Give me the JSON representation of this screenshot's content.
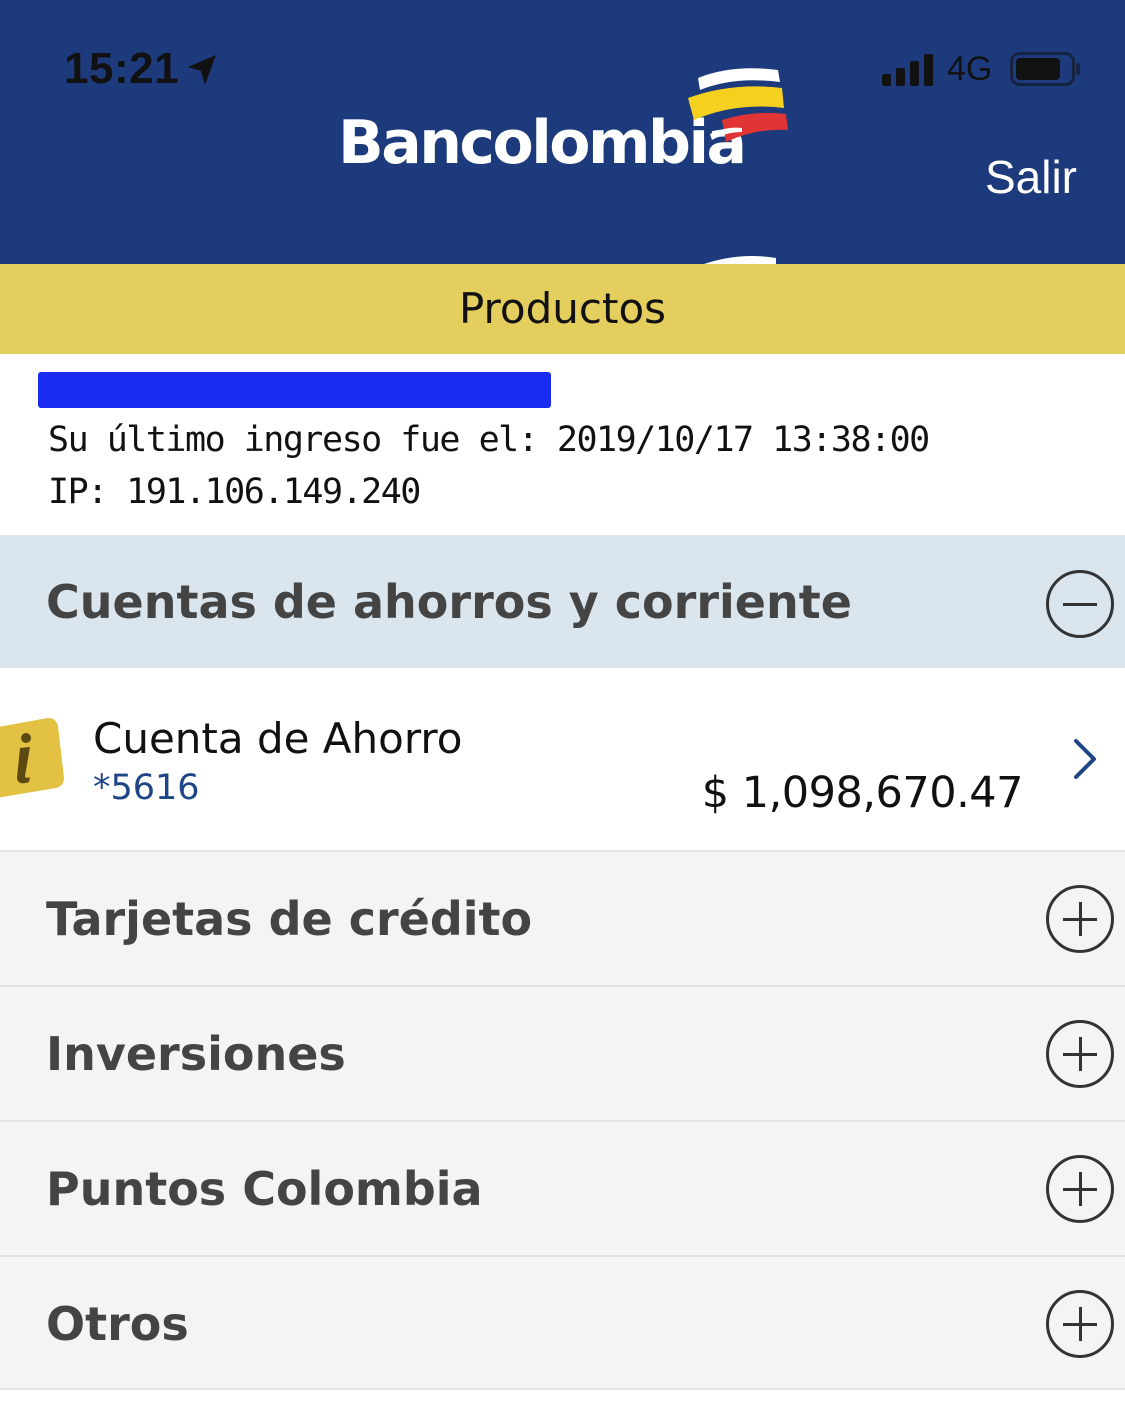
{
  "status_bar": {
    "time": "15:21",
    "network": "4G",
    "icons": [
      "location-arrow-icon",
      "signal-icon",
      "battery-icon"
    ]
  },
  "header": {
    "brand": "Bancolombia",
    "logout_label": "Salir",
    "background_color": "#1c3a7c"
  },
  "title_bar": {
    "title": "Productos",
    "color": "#e4ce5d"
  },
  "user_info": {
    "name_redacted": true,
    "last_login": "Su último ingreso fue el: 2019/10/17 13:38:00",
    "ip": "IP: 191.106.149.240"
  },
  "sections": [
    {
      "title": "Cuentas de ahorros y corriente",
      "expanded": true,
      "icon": "collapse-icon",
      "accounts": [
        {
          "name": "Cuenta de Ahorro",
          "number": "*5616",
          "balance": "$ 1,098,670.47"
        }
      ]
    },
    {
      "title": "Tarjetas de crédito",
      "expanded": false,
      "icon": "expand-icon"
    },
    {
      "title": "Inversiones",
      "expanded": false,
      "icon": "expand-icon"
    },
    {
      "title": "Puntos Colombia",
      "expanded": false,
      "icon": "expand-icon"
    },
    {
      "title": "Otros",
      "expanded": false,
      "icon": "expand-icon"
    }
  ]
}
